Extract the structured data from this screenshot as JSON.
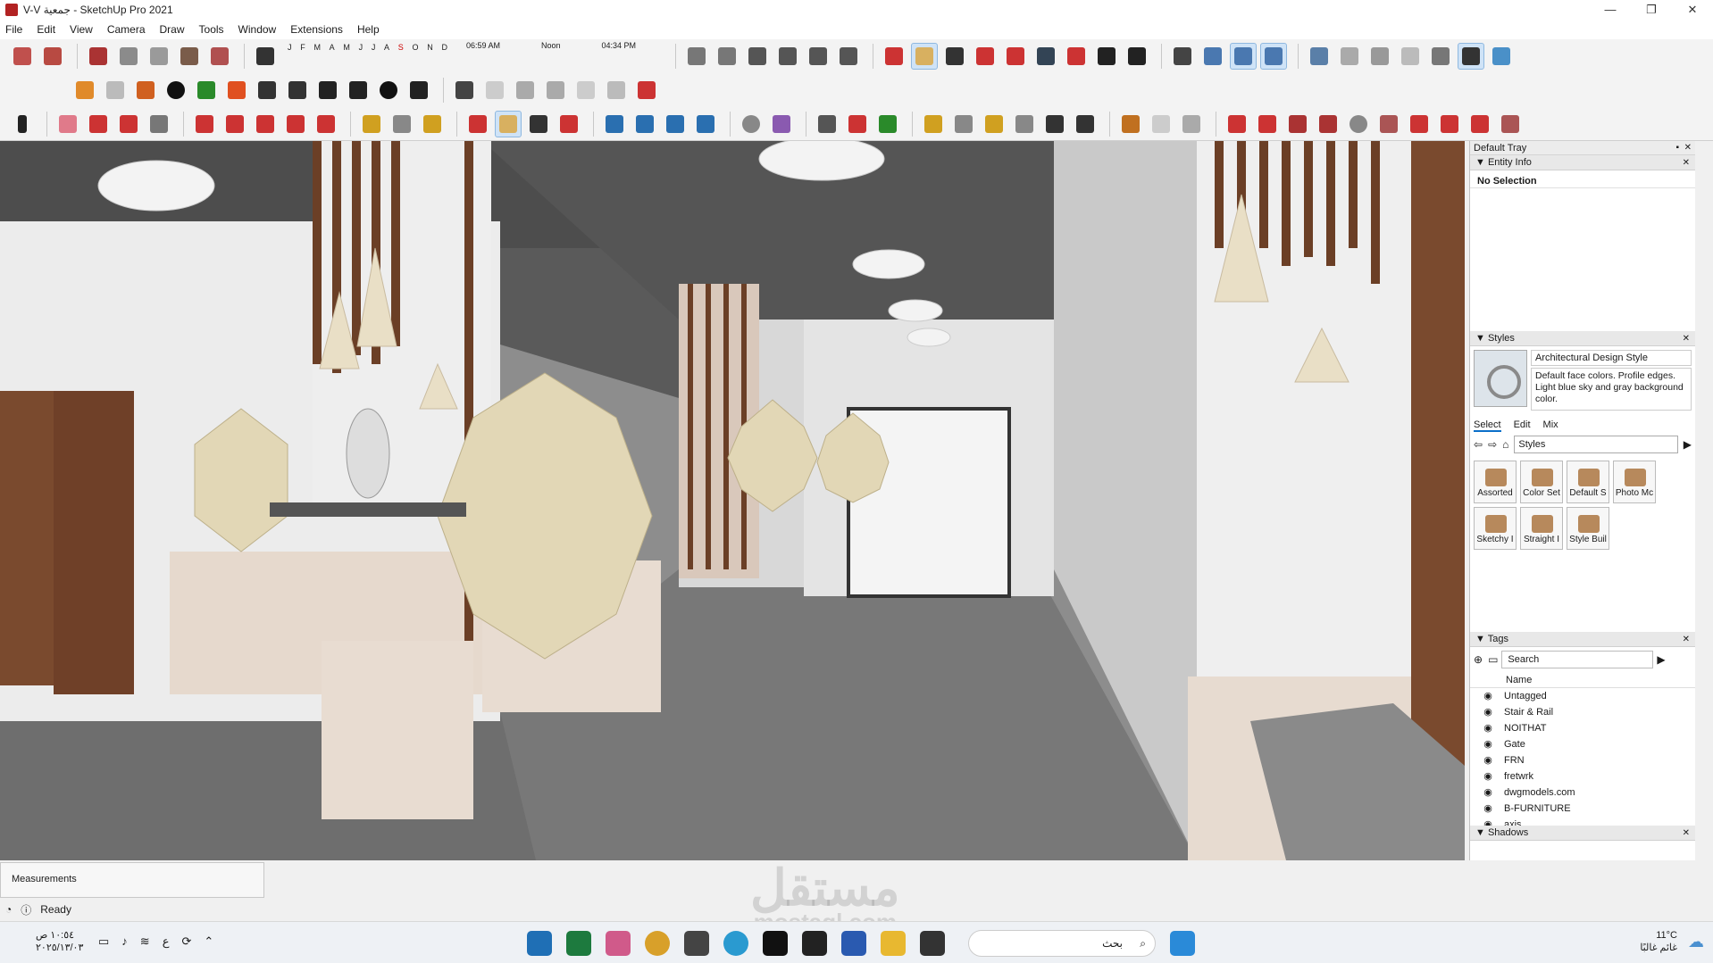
{
  "window": {
    "title": "V-V جمعية - SketchUp Pro 2021",
    "minimize": "—",
    "maximize": "❐",
    "close": "✕"
  },
  "menu": [
    "File",
    "Edit",
    "View",
    "Camera",
    "Draw",
    "Tools",
    "Window",
    "Extensions",
    "Help"
  ],
  "shadows": {
    "months": [
      "J",
      "F",
      "M",
      "A",
      "M",
      "J",
      "J",
      "A",
      "S",
      "O",
      "N",
      "D"
    ],
    "time_start": "06:59 AM",
    "time_mid": "Noon",
    "time_end": "04:34 PM"
  },
  "tray": {
    "title": "Default Tray",
    "entity_info": {
      "title": "Entity Info",
      "value": "No Selection"
    },
    "styles": {
      "title": "Styles",
      "name": "Architectural Design Style",
      "description": "Default face colors. Profile edges. Light blue sky and gray background color.",
      "tabs": [
        "Select",
        "Edit",
        "Mix"
      ],
      "collection": "Styles",
      "items": [
        "Assorted",
        "Color Set",
        "Default S",
        "Photo Mc",
        "Sketchy I",
        "Straight I",
        "Style Buil"
      ]
    },
    "tags": {
      "title": "Tags",
      "search_placeholder": "Search",
      "column": "Name",
      "items": [
        "Untagged",
        "Stair & Rail",
        "NOITHAT",
        "Gate",
        "FRN",
        "fretwrk",
        "dwgmodels.com",
        "B-FURNITURE",
        "axis"
      ]
    },
    "shadows_title": "Shadows"
  },
  "measurements_label": "Measurements",
  "status": "Ready",
  "taskbar": {
    "time": "١٠:٥٤ ص",
    "date": "٢٠٢٥/١٣/٠٣",
    "search": "بحث",
    "weather_temp": "11°C",
    "weather_desc": "غائم غالبًا",
    "lang": "ع"
  },
  "watermark": {
    "arabic": "مستقل",
    "latin": "mostaql.com"
  }
}
